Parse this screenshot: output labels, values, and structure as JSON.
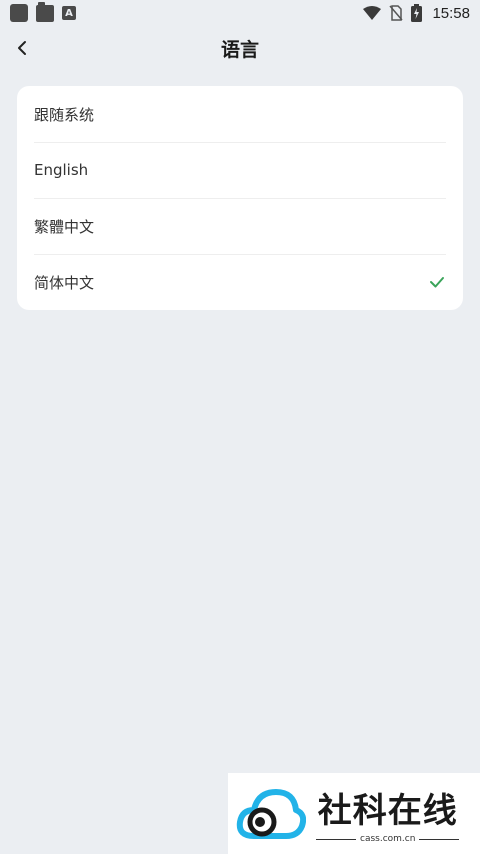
{
  "status_bar": {
    "time": "15:58"
  },
  "header": {
    "title": "语言"
  },
  "languages": [
    {
      "label": "跟随系统",
      "selected": false
    },
    {
      "label": "English",
      "selected": false
    },
    {
      "label": "繁體中文",
      "selected": false
    },
    {
      "label": "简体中文",
      "selected": true
    }
  ],
  "colors": {
    "accent": "#3aa45a",
    "background": "#ebeef2",
    "card": "#ffffff"
  },
  "watermark": {
    "name": "社科在线",
    "url": "cass.com.cn"
  }
}
